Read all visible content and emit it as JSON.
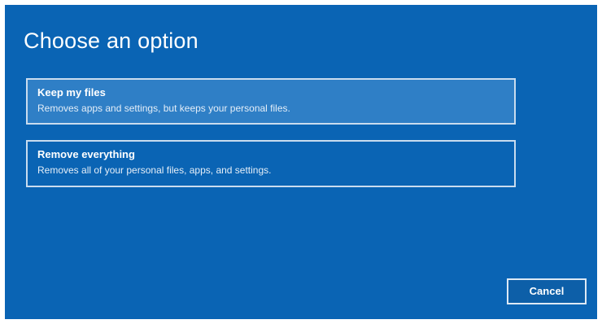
{
  "dialog": {
    "title": "Choose an option",
    "background_color": "#0a64b4",
    "options": [
      {
        "title": "Keep my files",
        "description": "Removes apps and settings, but keeps your personal files.",
        "highlighted": true
      },
      {
        "title": "Remove everything",
        "description": "Removes all of your personal files, apps, and settings.",
        "highlighted": false
      }
    ],
    "cancel_label": "Cancel"
  }
}
